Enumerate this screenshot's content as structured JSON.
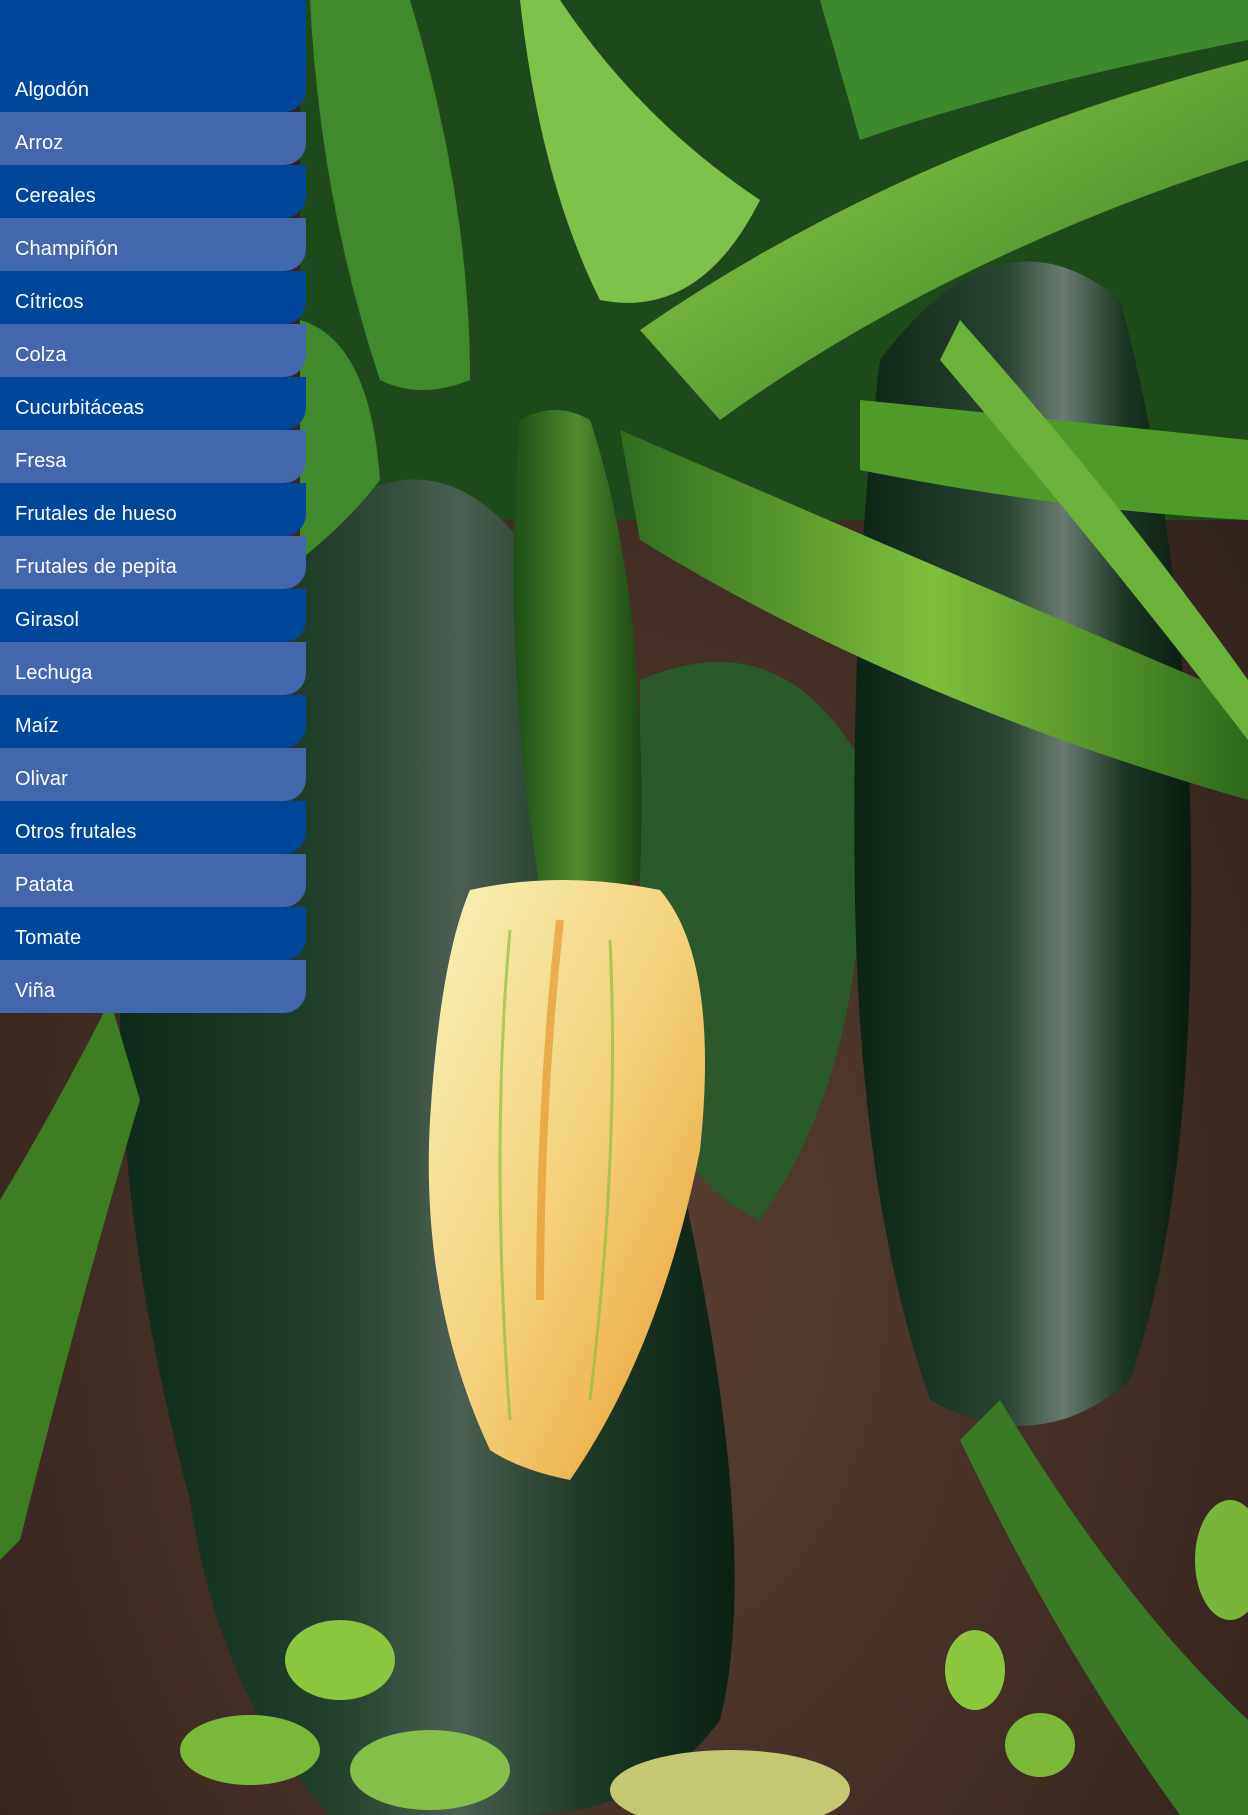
{
  "menu": {
    "items": [
      {
        "label": "Algodón"
      },
      {
        "label": "Arroz"
      },
      {
        "label": "Cereales"
      },
      {
        "label": "Champiñón"
      },
      {
        "label": "Cítricos"
      },
      {
        "label": "Colza"
      },
      {
        "label": "Cucurbitáceas"
      },
      {
        "label": "Fresa"
      },
      {
        "label": "Frutales de hueso"
      },
      {
        "label": "Frutales de pepita"
      },
      {
        "label": "Girasol"
      },
      {
        "label": "Lechuga"
      },
      {
        "label": "Maíz"
      },
      {
        "label": "Olivar"
      },
      {
        "label": "Otros frutales"
      },
      {
        "label": "Patata"
      },
      {
        "label": "Tomate"
      },
      {
        "label": "Viña"
      }
    ]
  },
  "colors": {
    "menu_dark": "#00479b",
    "menu_light": "#4267ad",
    "menu_text": "#ffffff"
  }
}
